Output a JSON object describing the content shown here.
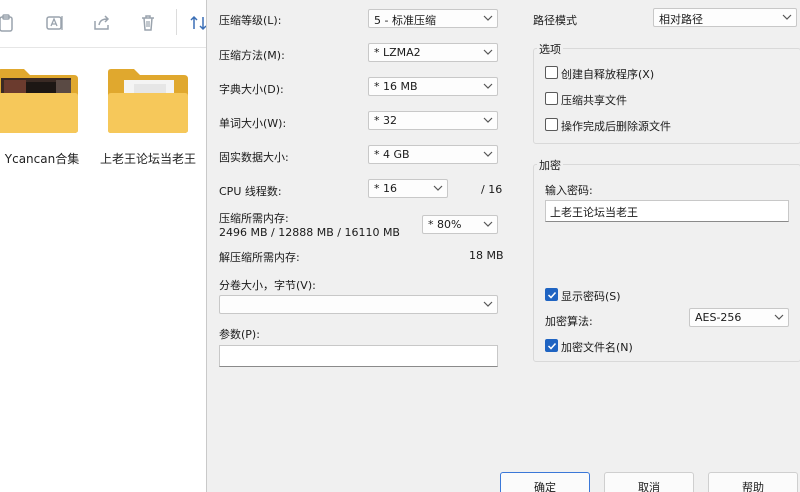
{
  "explorer": {
    "folders": [
      {
        "label": "Ycancan合集"
      },
      {
        "label": "上老王论坛当老王"
      }
    ]
  },
  "dialog": {
    "compression_level": {
      "label": "压缩等级(L):",
      "value": "5 - 标准压缩"
    },
    "compression_method": {
      "label": "压缩方法(M):",
      "value": "* LZMA2"
    },
    "dictionary_size": {
      "label": "字典大小(D):",
      "value": "* 16 MB"
    },
    "word_size": {
      "label": "单词大小(W):",
      "value": "* 32"
    },
    "solid_block_size": {
      "label": "固实数据大小:",
      "value": "* 4 GB"
    },
    "cpu_threads": {
      "label": "CPU 线程数:",
      "value": "* 16",
      "total": "/ 16"
    },
    "memory_compress": {
      "label": "压缩所需内存:",
      "detail": "2496 MB / 12888 MB / 16110 MB",
      "value": "* 80%"
    },
    "memory_decompress": {
      "label": "解压缩所需内存:",
      "value": "18 MB"
    },
    "volume_split": {
      "label": "分卷大小，字节(V):",
      "value": ""
    },
    "parameters": {
      "label": "参数(P):",
      "value": ""
    },
    "path_mode": {
      "label": "路径模式",
      "value": "相对路径"
    },
    "options": {
      "title": "选项",
      "items": [
        {
          "label": "创建自释放程序(X)",
          "checked": false
        },
        {
          "label": "压缩共享文件",
          "checked": false
        },
        {
          "label": "操作完成后删除源文件",
          "checked": false
        }
      ]
    },
    "encryption": {
      "title": "加密",
      "password_label": "输入密码:",
      "password_value": "上老王论坛当老王",
      "show_password": {
        "label": "显示密码(S)",
        "checked": true
      },
      "method_label": "加密算法:",
      "method_value": "AES-256",
      "encrypt_names": {
        "label": "加密文件名(N)",
        "checked": true
      }
    },
    "buttons": {
      "ok": "确定",
      "cancel": "取消",
      "help": "帮助"
    }
  }
}
